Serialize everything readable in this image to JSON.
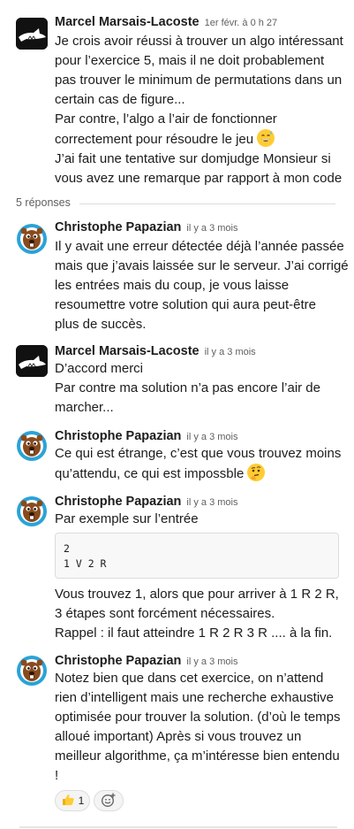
{
  "thread": {
    "parent": {
      "author": "Marcel Marsais-Lacoste",
      "time": "1er févr. à 0 h 27",
      "lines": [
        "Je crois avoir réussi à trouver un algo intéressant",
        "pour l’exercice 5, mais il ne doit probablement",
        "pas trouver le minimum de permutations dans un",
        "certain cas de figure...",
        "Par contre, l’algo a l’air de fonctionner",
        "correctement pour résoudre le jeu",
        "J’ai fait une tentative sur domjudge Monsieur si",
        "vous avez une remarque par rapport à mon code"
      ]
    },
    "replies_label": "5 réponses",
    "replies": [
      {
        "author": "Christophe Papazian",
        "time": "il y a 3 mois",
        "lines": [
          "Il y avait une erreur détectée déjà l’année passée",
          "mais que j’avais laissée sur le serveur. J’ai corrigé",
          "les entrées mais du coup, je vous laisse",
          "resoumettre votre solution qui aura peut-être",
          "plus de succès."
        ]
      },
      {
        "author": "Marcel Marsais-Lacoste",
        "time": "il y a 3 mois",
        "lines": [
          "D’accord merci",
          "Par contre ma solution n’a pas encore l’air de",
          "marcher..."
        ]
      },
      {
        "author": "Christophe Papazian",
        "time": "il y a 3 mois",
        "lines": [
          "Ce qui est étrange, c’est que vous trouvez moins",
          "qu’attendu, ce qui est impossble"
        ]
      },
      {
        "author": "Christophe Papazian",
        "time": "il y a 3 mois",
        "intro": "Par exemple sur l’entrée",
        "code": [
          "2",
          "1 V 2 R"
        ],
        "lines": [
          "Vous trouvez 1, alors que pour arriver à 1 R 2 R,",
          "3 étapes sont forcément nécessaires.",
          "Rappel : il faut atteindre 1 R 2 R 3 R .... à la fin."
        ]
      },
      {
        "author": "Christophe Papazian",
        "time": "il y a 3 mois",
        "lines": [
          "Notez bien que dans cet exercice, on n’attend",
          "rien d’intelligent mais une recherche exhaustive",
          "optimisée pour trouver la solution. (d’où le temps",
          "alloué important) Après si vous trouvez un",
          "meilleur algorithme, ça m’intéresse bien entendu",
          "!"
        ],
        "reaction": {
          "icon": "thumbs-up-icon",
          "count": "1"
        }
      }
    ]
  },
  "colors": {
    "text": "#1d1c1d",
    "muted": "#616061",
    "border": "#dddddd",
    "code_bg": "#f8f8f8"
  }
}
